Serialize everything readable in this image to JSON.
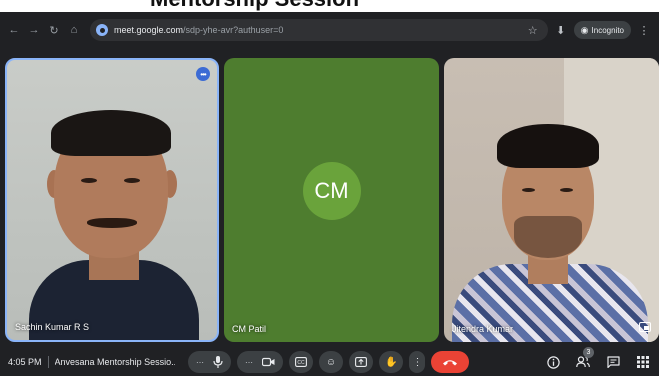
{
  "page": {
    "cropped_heading": "Mentorship Session"
  },
  "browser": {
    "url_host": "meet.google.com",
    "url_path": "/sdp-yhe-avr?authuser=0",
    "incognito_label": "Incognito"
  },
  "participants": [
    {
      "name": "Sachin Kumar R S",
      "border_color": "#8ab4f8"
    },
    {
      "name": "CM Patil",
      "initials": "CM",
      "tile_color": "#4e7d2f",
      "avatar_color": "#6aa33b"
    },
    {
      "name": "Jitendra Kumar"
    }
  ],
  "bottom_bar": {
    "time": "4:05 PM",
    "meeting_name": "Anvesana Mentorship Sessio...",
    "participants_count": "3",
    "end_call_color": "#ea4335"
  }
}
